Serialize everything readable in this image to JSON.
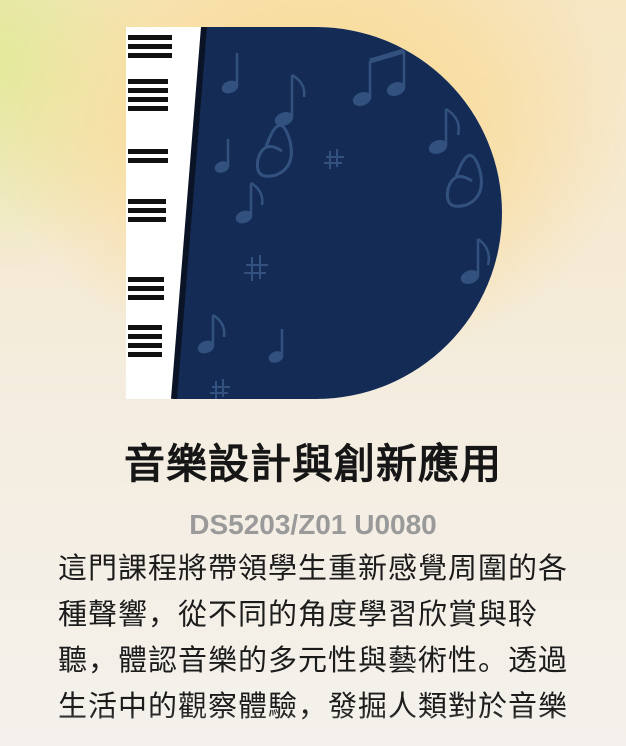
{
  "course": {
    "title": "音樂設計與創新應用",
    "code": "DS5203/Z01 U0080",
    "description": "這門課程將帶領學生重新感覺周圍的各種聲響，從不同的角度學習欣賞與聆聽，體認音樂的多元性與藝術性。透過生活中的觀察體驗，發掘人類對於音樂"
  },
  "logo": {
    "icon": "piano-music-d-logo-icon",
    "colors": {
      "navy": "#142c55",
      "keys_white": "#ffffff",
      "keys_black": "#111111",
      "notes": "#3e5e8c"
    }
  }
}
